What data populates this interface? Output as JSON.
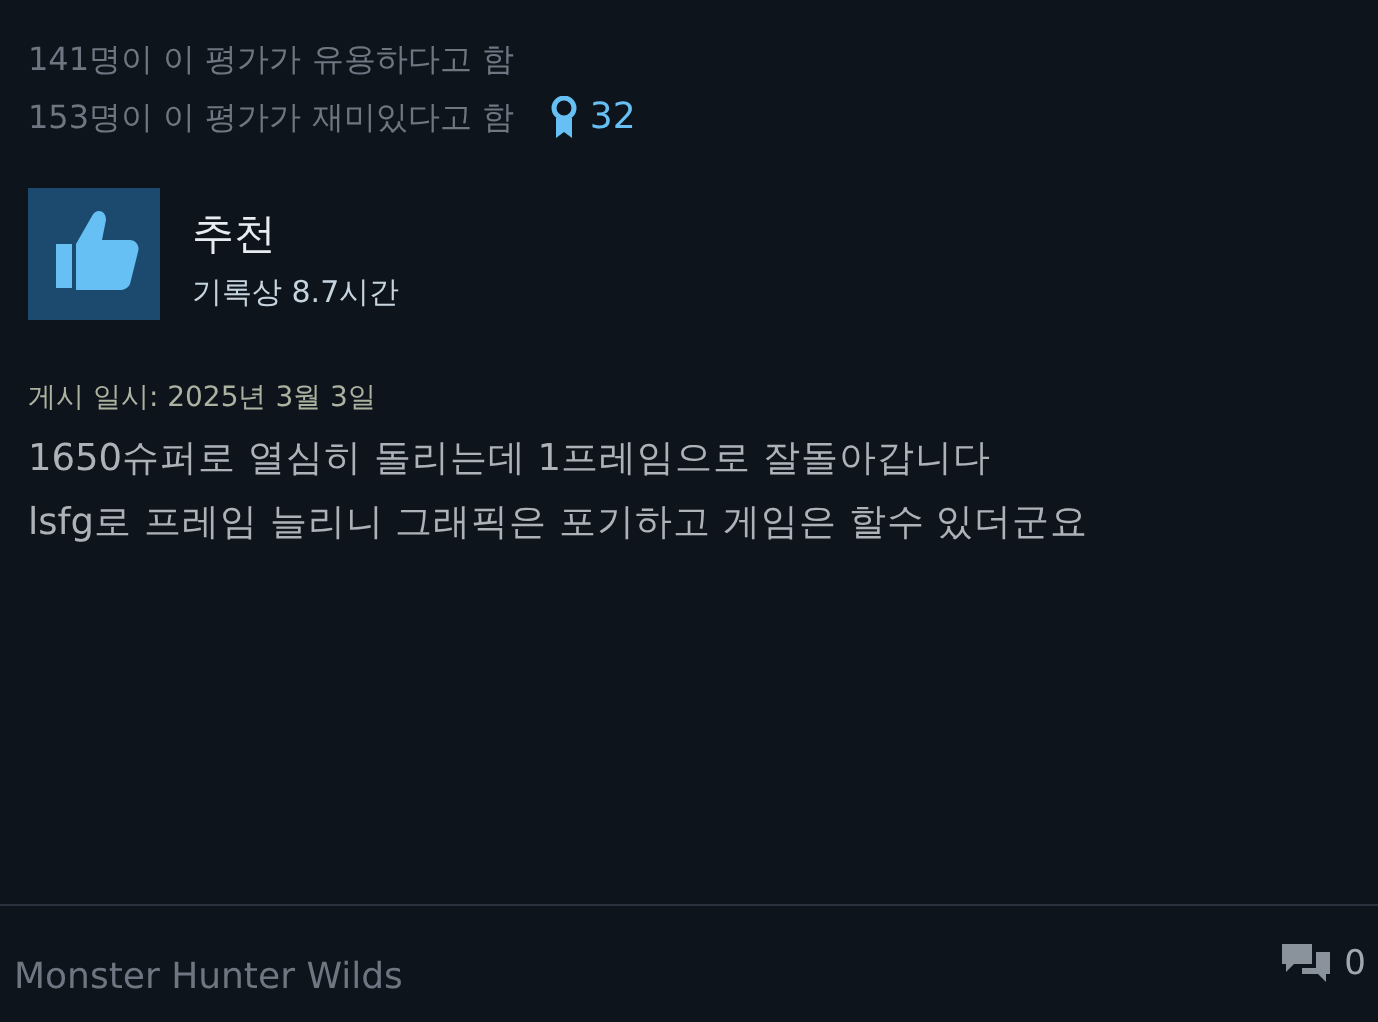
{
  "votes": {
    "helpful": "141명이 이 평가가 유용하다고 함",
    "funny": "153명이 이 평가가 재미있다고 함",
    "awards": "32"
  },
  "review": {
    "recommended": true,
    "verdict": "추천",
    "hours": "기록상 8.7시간",
    "posted": "게시 일시: 2025년 3월 3일",
    "body": [
      "1650슈퍼로 열심히 돌리는데 1프레임으로 잘돌아갑니다",
      "lsfg로 프레임 늘리니 그래픽은 포기하고 게임은 할수 있더군요"
    ]
  },
  "footer": {
    "game": "Monster Hunter Wilds",
    "comments": "0"
  }
}
